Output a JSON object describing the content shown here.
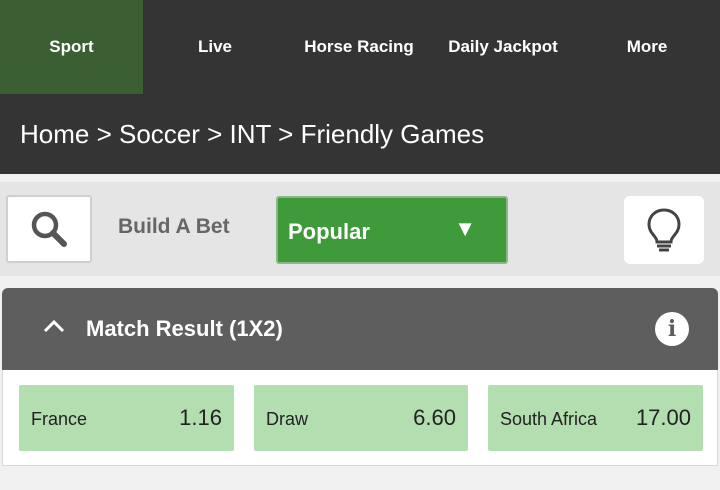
{
  "nav": [
    "Sport",
    "Live",
    "Horse Racing",
    "Daily Jackpot",
    "More"
  ],
  "breadcrumb": "Home > Soccer > INT > Friendly Games",
  "toolbar": {
    "build_a_bet": "Build A Bet",
    "dropdown_value": "Popular",
    "dropdown_arrow": "▼"
  },
  "market": {
    "title": "Match Result (1X2)",
    "info_symbol": "i",
    "outcomes": [
      {
        "name": "France",
        "odds": "1.16"
      },
      {
        "name": "Draw",
        "odds": "6.60"
      },
      {
        "name": "South Africa",
        "odds": "17.00"
      }
    ]
  },
  "colors": {
    "nav_bg": "#343434",
    "nav_active": "#3b5e33",
    "dropdown_green": "#3f9a3a",
    "odds_green": "#b3deaf",
    "market_header": "#5e5e5e"
  },
  "icons": [
    "search-icon",
    "lightbulb-icon",
    "chevron-up-icon",
    "info-icon",
    "dropdown-arrow-icon"
  ]
}
